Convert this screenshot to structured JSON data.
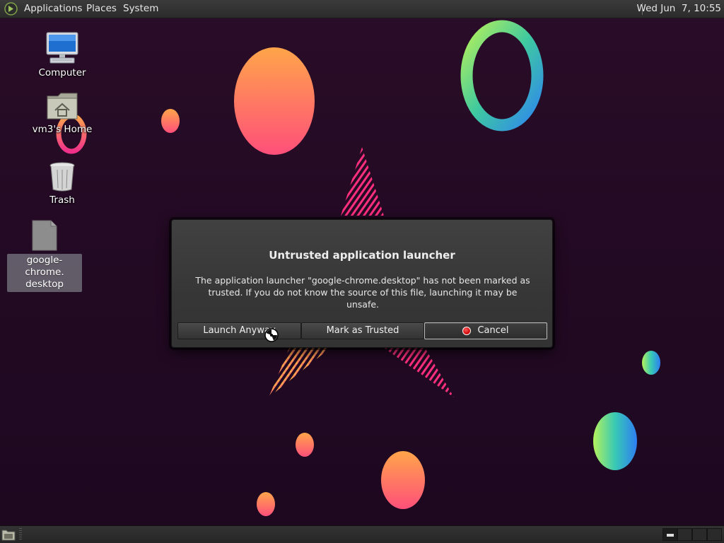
{
  "top_panel": {
    "menus": [
      "Applications",
      "Places",
      "System"
    ],
    "clock": "Wed Jun  7, 10:55"
  },
  "desktop_icons": [
    {
      "label": "Computer",
      "icon": "computer-icon"
    },
    {
      "label": "vm3's Home",
      "icon": "home-folder-icon"
    },
    {
      "label": "Trash",
      "icon": "trash-icon"
    },
    {
      "label": "google-chrome.\ndesktop",
      "icon": "desktop-file-icon"
    }
  ],
  "dialog": {
    "title": "Untrusted application launcher",
    "message": "The application launcher \"google-chrome.desktop\" has not been marked as trusted. If you do not know the source of this file, launching it may be unsafe.",
    "buttons": {
      "launch": "Launch Anyway",
      "trust": "Mark as Trusted",
      "cancel": "Cancel"
    }
  },
  "colors": {
    "panel_bg": "#2f2f2f",
    "dialog_bg": "#3a3a3a",
    "wallpaper_bg": "#240a24",
    "cancel_icon": "#d40000"
  }
}
